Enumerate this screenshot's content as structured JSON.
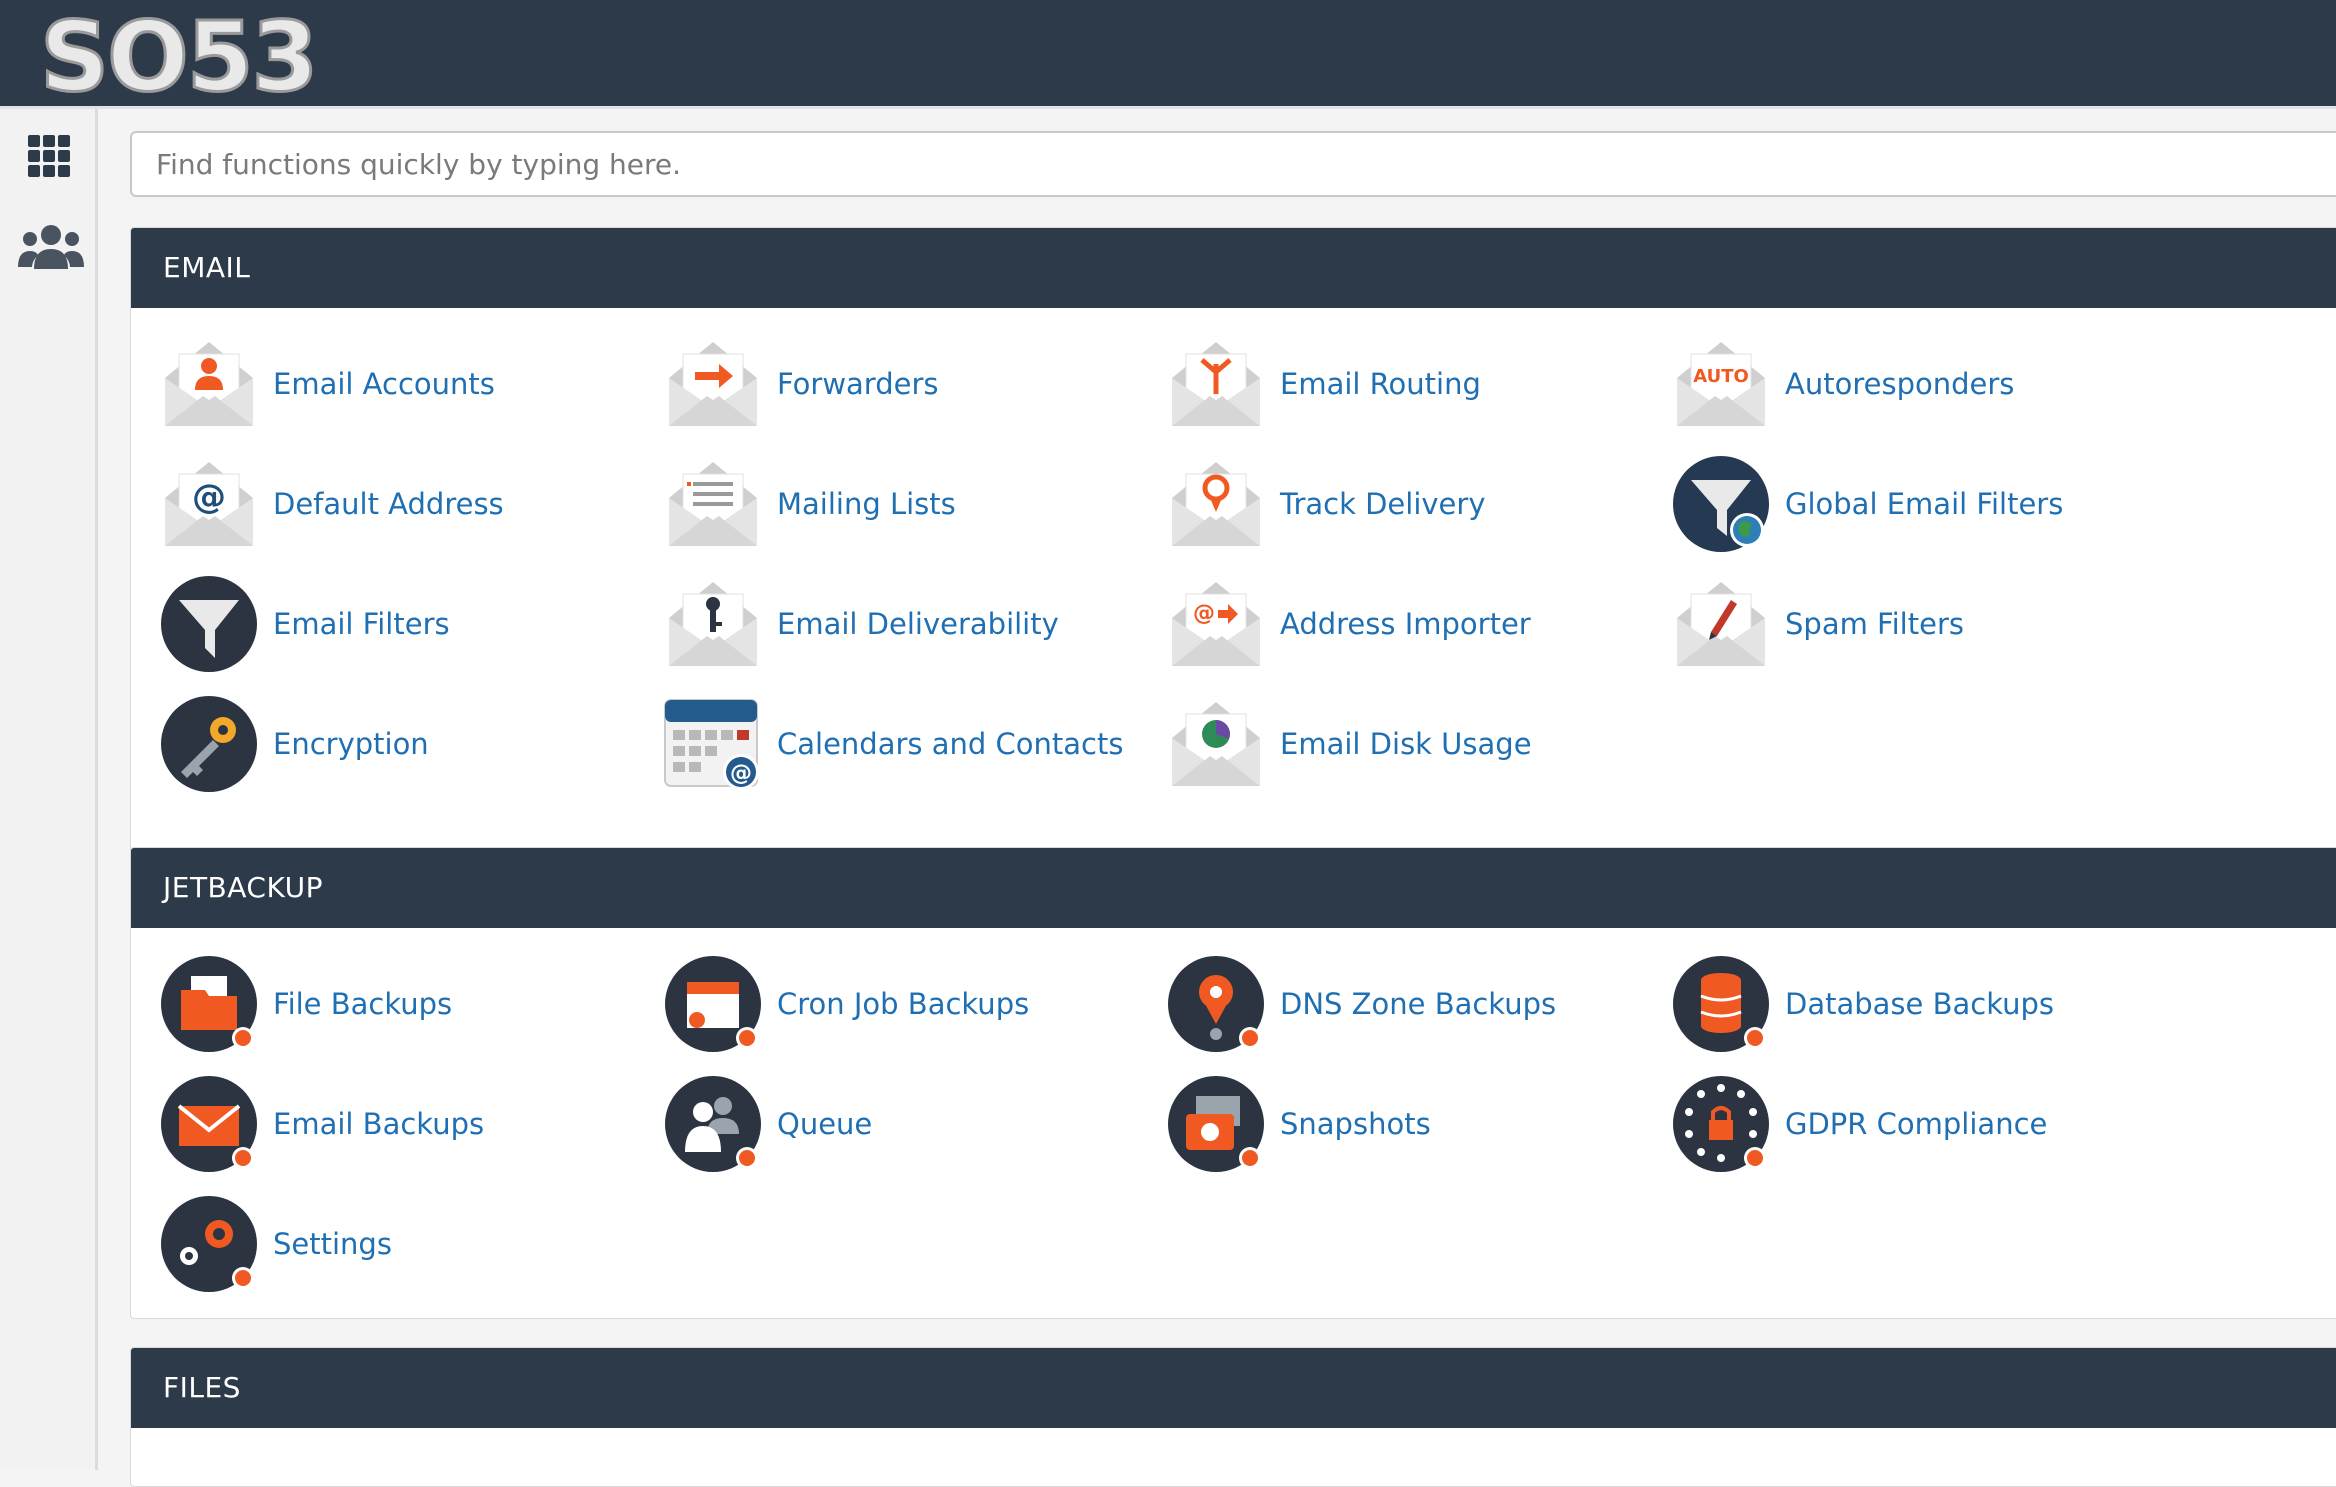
{
  "header": {
    "logo_text": "SO53"
  },
  "search": {
    "placeholder": "Find functions quickly by typing here."
  },
  "sections": [
    {
      "title": "EMAIL",
      "items": [
        {
          "label": "Email Accounts",
          "icon": "envelope-person-icon"
        },
        {
          "label": "Forwarders",
          "icon": "envelope-arrow-icon"
        },
        {
          "label": "Email Routing",
          "icon": "envelope-routing-icon"
        },
        {
          "label": "Autoresponders",
          "icon": "envelope-auto-icon",
          "badge": "AUTO"
        },
        {
          "label": "Default Address",
          "icon": "envelope-at-icon"
        },
        {
          "label": "Mailing Lists",
          "icon": "envelope-list-icon"
        },
        {
          "label": "Track Delivery",
          "icon": "envelope-pin-icon"
        },
        {
          "label": "Global Email Filters",
          "icon": "funnel-globe-icon"
        },
        {
          "label": "Email Filters",
          "icon": "funnel-icon"
        },
        {
          "label": "Email Deliverability",
          "icon": "envelope-key-icon"
        },
        {
          "label": "Address Importer",
          "icon": "envelope-import-icon"
        },
        {
          "label": "Spam Filters",
          "icon": "envelope-pen-icon"
        },
        {
          "label": "Encryption",
          "icon": "key-icon"
        },
        {
          "label": "Calendars and Contacts",
          "icon": "calendar-at-icon"
        },
        {
          "label": "Email Disk Usage",
          "icon": "envelope-pie-icon"
        }
      ]
    },
    {
      "title": "JETBACKUP",
      "items": [
        {
          "label": "File Backups",
          "icon": "folder-backup-icon"
        },
        {
          "label": "Cron Job Backups",
          "icon": "calendar-backup-icon"
        },
        {
          "label": "DNS Zone Backups",
          "icon": "pin-backup-icon"
        },
        {
          "label": "Database Backups",
          "icon": "database-backup-icon"
        },
        {
          "label": "Email Backups",
          "icon": "mail-backup-icon"
        },
        {
          "label": "Queue",
          "icon": "people-backup-icon"
        },
        {
          "label": "Snapshots",
          "icon": "camera-backup-icon"
        },
        {
          "label": "GDPR Compliance",
          "icon": "gdpr-lock-icon"
        },
        {
          "label": "Settings",
          "icon": "gears-backup-icon"
        }
      ]
    },
    {
      "title": "FILES",
      "items": []
    }
  ],
  "colors": {
    "header_bg": "#2c3a49",
    "link": "#1f6fb2",
    "accent_orange": "#f05a22",
    "icon_dark": "#2b3440",
    "envelope_gray": "#cfcfcf"
  }
}
